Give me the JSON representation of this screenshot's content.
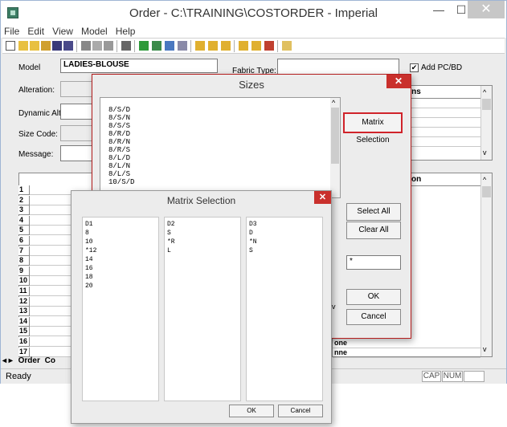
{
  "window": {
    "title": "Order - C:\\TRAINING\\COSTORDER - Imperial",
    "min": "—",
    "max": "☐",
    "close": "✕"
  },
  "menu": [
    "File",
    "Edit",
    "View",
    "Model",
    "Help"
  ],
  "form": {
    "model_label": "Model",
    "model_value": "LADIES-BLOUSE",
    "fabric_type_label": "Fabric Type:",
    "fabric_type_value": "",
    "add_pcbd_label": "Add PC/BD",
    "add_pcbd_checked": "✔",
    "alteration_label": "Alteration:",
    "dynamic_alt_label": "Dynamic Alt:",
    "size_code_label": "Size Code:",
    "message_label": "Message:"
  },
  "right_panels": {
    "top_header": "ons",
    "bottom_header": "on",
    "bottom_rows": [
      "one",
      "nne"
    ]
  },
  "grid": {
    "row_numbers": [
      "1",
      "2",
      "3",
      "4",
      "5",
      "6",
      "7",
      "8",
      "9",
      "10",
      "11",
      "12",
      "13",
      "14",
      "15",
      "16",
      "17"
    ]
  },
  "tabs": {
    "nav": "◂ ▸",
    "order_tab": "Order",
    "next_tab": "Co"
  },
  "status": {
    "text": "Ready",
    "cap": "CAP",
    "num": "NUM"
  },
  "sizes_dialog": {
    "title": "Sizes",
    "close": "✕",
    "items": [
      "8/S/D",
      "8/S/N",
      "8/S/S",
      "8/R/D",
      "8/R/N",
      "8/R/S",
      "8/L/D",
      "8/L/N",
      "8/L/S",
      "10/S/D"
    ],
    "matrix_selection_button": "Matrix Selection",
    "select_all_button": "Select All",
    "clear_all_button": "Clear All",
    "filter_value": "*",
    "ok_button": "OK",
    "cancel_button": "Cancel",
    "scroll_up": "^",
    "scroll_down": "v"
  },
  "matrix_dialog": {
    "title": "Matrix Selection",
    "close": "✕",
    "columns": [
      {
        "header": "D1",
        "items": [
          "8",
          "10",
          "*12",
          "14",
          "16",
          "18",
          "20"
        ]
      },
      {
        "header": "D2",
        "items": [
          "S",
          "*R",
          "L"
        ]
      },
      {
        "header": "D3",
        "items": [
          "D",
          "*N",
          "S"
        ]
      }
    ],
    "ok_button": "OK",
    "cancel_button": "Cancel"
  },
  "colors": {
    "highlight_border": "#d0232a",
    "close_red": "#c9302c"
  }
}
